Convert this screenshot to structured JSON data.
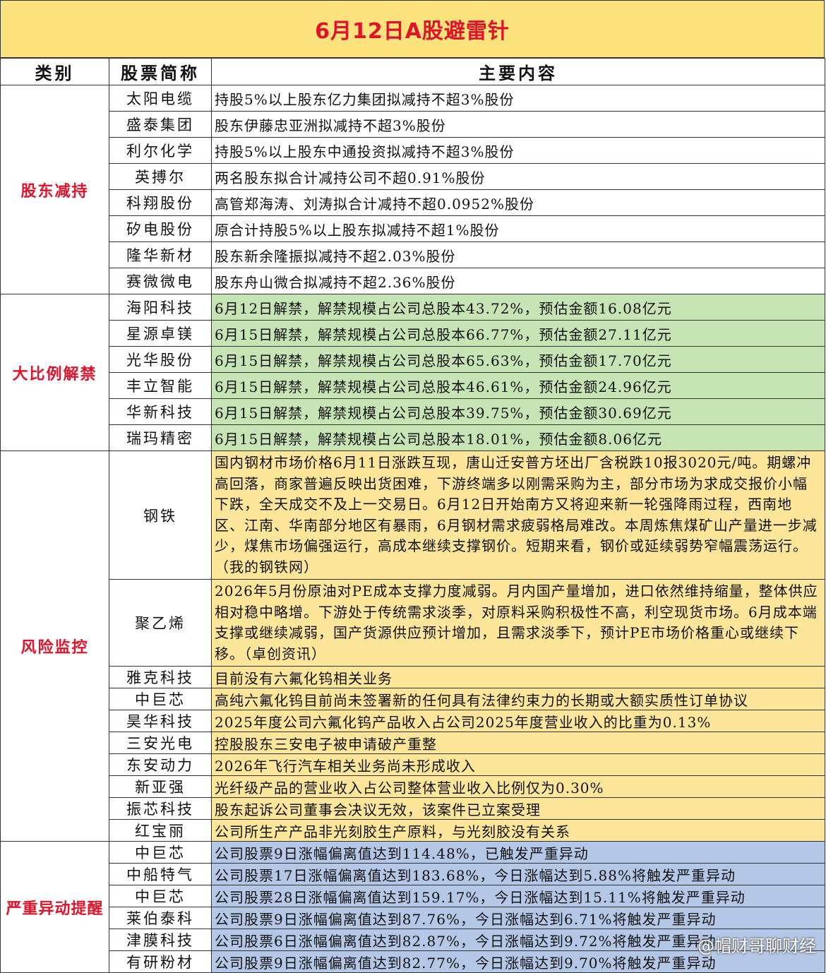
{
  "title": "6月12日A股避雷针",
  "headers": {
    "category": "类别",
    "stock": "股票简称",
    "content": "主要内容"
  },
  "groups": [
    {
      "category": "股东减持",
      "rows": [
        {
          "stock": "太阳电缆",
          "content": "持股5%以上股东亿力集团拟减持不超3%股份"
        },
        {
          "stock": "盛泰集团",
          "content": "股东伊藤忠亚洲拟减持不超3%股份"
        },
        {
          "stock": "利尔化学",
          "content": "持股5%以上股东中通投资拟减持不超3%股份"
        },
        {
          "stock": "英搏尔",
          "content": "两名股东拟合计减持公司不超0.91%股份"
        },
        {
          "stock": "科翔股份",
          "content": "高管郑海涛、刘涛拟合计减持不超0.0952%股份"
        },
        {
          "stock": "矽电股份",
          "content": "原合计持股5%以上股东拟减持不超1%股份"
        },
        {
          "stock": "隆华新材",
          "content": "股东新余隆振拟减持不超2.03%股份"
        },
        {
          "stock": "赛微微电",
          "content": "股东舟山微合拟减持不超2.36%股份"
        }
      ]
    },
    {
      "category": "大比例解禁",
      "rows": [
        {
          "stock": "海阳科技",
          "content": "6月12日解禁，解禁规模占公司总股本43.72%，预估金额16.08亿元"
        },
        {
          "stock": "星源卓镁",
          "content": "6月15日解禁，解禁规模占公司总股本66.77%，预估金额27.11亿元"
        },
        {
          "stock": "光华股份",
          "content": "6月15日解禁，解禁规模占公司总股本65.63%，预估金额17.70亿元"
        },
        {
          "stock": "丰立智能",
          "content": "6月15日解禁，解禁规模占公司总股本46.61%，预估金额24.96亿元"
        },
        {
          "stock": "华新科技",
          "content": "6月15日解禁，解禁规模占公司总股本39.75%，预估金额30.69亿元"
        },
        {
          "stock": "瑞玛精密",
          "content": "6月15日解禁，解禁规模占公司总股本18.01%，预估金额8.06亿元"
        }
      ]
    },
    {
      "category": "风险监控",
      "rows": [
        {
          "stock": "钢铁",
          "content": "国内钢材市场价格6月11日涨跌互现，唐山迁安普方坯出厂含税跌10报3020元/吨。期螺冲高回落，商家普遍反映出货困难，下游终端多以刚需采购为主，部分市场为求成交报价小幅下跌，全天成交不及上一交易日。6月12日开始南方又将迎来新一轮强降雨过程，西南地区、江南、华南部分地区有暴雨，6月钢材需求疲弱格局难改。本周炼焦煤矿山产量进一步减少，煤焦市场偏强运行，高成本继续支撑钢价。短期来看，钢价或延续弱势窄幅震荡运行。（我的钢铁网）"
        },
        {
          "stock": "聚乙烯",
          "content": "2026年5月份原油对PE成本支撑力度减弱。月内国产量增加，进口依然维持缩量，整体供应相对稳中略增。下游处于传统需求淡季，对原料采购积极性不高，利空现货市场。6月成本端支撑或继续减弱，国产货源供应预计增加，且需求淡季下，预计PE市场价格重心或继续下移。（卓创资讯）"
        },
        {
          "stock": "雅克科技",
          "content": "目前没有六氟化钨相关业务"
        },
        {
          "stock": "中巨芯",
          "content": "高纯六氟化钨目前尚未签署新的任何具有法律约束力的长期或大额实质性订单协议"
        },
        {
          "stock": "昊华科技",
          "content": "2025年度公司六氟化钨产品收入占公司2025年度营业收入的比重为0.13%"
        },
        {
          "stock": "三安光电",
          "content": "控股股东三安电子被申请破产重整"
        },
        {
          "stock": "东安动力",
          "content": "2026年飞行汽车相关业务尚未形成收入"
        },
        {
          "stock": "新亚强",
          "content": "光纤级产品的营业收入占公司整体营业收入比例仅为0.30%"
        },
        {
          "stock": "振芯科技",
          "content": "股东起诉公司董事会决议无效，该案件已立案受理"
        },
        {
          "stock": "红宝丽",
          "content": "公司所生产产品非光刻胶生产原料，与光刻胶没有关系"
        }
      ]
    },
    {
      "category": "严重异动提醒",
      "rows": [
        {
          "stock": "中巨芯",
          "content": "公司股票9日涨幅偏离值达到114.48%，已触发严重异动"
        },
        {
          "stock": "中船特气",
          "content": "公司股票17日涨幅偏离值达到183.68%，今日涨幅达到5.88%将触发严重异动"
        },
        {
          "stock": "中巨芯",
          "content": "公司股票28日涨幅偏离值达到159.17%，今日涨幅达到15.11%将触发严重异动"
        },
        {
          "stock": "莱伯泰科",
          "content": "公司股票9日涨幅偏离值达到87.76%，今日涨幅达到6.71%将触发严重异动"
        },
        {
          "stock": "津膜科技",
          "content": "公司股票6日涨幅偏离值达到82.87%，今日涨幅达到9.72%将触发严重异动"
        },
        {
          "stock": "有研粉材",
          "content": "公司股票9日涨幅偏离值达到82.77%，今日涨幅达到9.70%将触发严重异动"
        }
      ]
    }
  ],
  "watermark": "@帽财哥聊财经",
  "colors": {
    "title_bg": "#fbe27d",
    "accent_red": "#e0132b",
    "green": "#c6e4b4",
    "yellow": "#fde59a",
    "blue": "#b4c7e7"
  }
}
